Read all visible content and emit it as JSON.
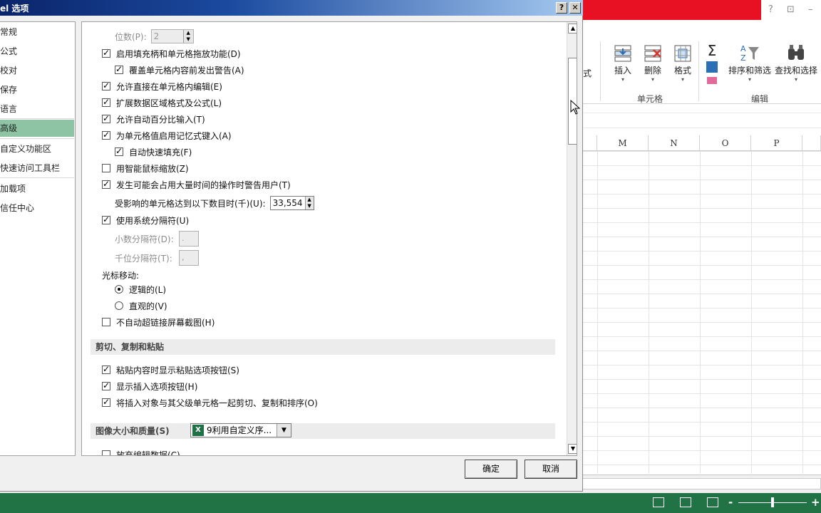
{
  "dialog": {
    "title": "el 选项",
    "help_button": "?",
    "close_button": "✕",
    "ok_label": "确定",
    "cancel_label": "取消"
  },
  "nav": {
    "items": [
      {
        "label": "常规"
      },
      {
        "label": "公式"
      },
      {
        "label": "校对"
      },
      {
        "label": "保存"
      },
      {
        "label": "语言"
      },
      {
        "label": "高级"
      },
      {
        "label": "自定义功能区"
      },
      {
        "label": "快速访问工具栏"
      },
      {
        "label": "加载项"
      },
      {
        "label": "信任中心"
      }
    ],
    "active": "高级"
  },
  "options": {
    "decimal_places_label": "位数(P):",
    "decimal_places_value": "2",
    "fill_handle": {
      "label": "启用填充柄和单元格拖放功能(D)",
      "checked": true
    },
    "overwrite_warn": {
      "label": "覆盖单元格内容前发出警告(A)",
      "checked": true
    },
    "edit_in_cell": {
      "label": "允许直接在单元格内编辑(E)",
      "checked": true
    },
    "extend_formats": {
      "label": "扩展数据区域格式及公式(L)",
      "checked": true
    },
    "auto_percent": {
      "label": "允许自动百分比输入(T)",
      "checked": true
    },
    "autocomplete": {
      "label": "为单元格值启用记忆式键入(A)",
      "checked": true
    },
    "flash_fill": {
      "label": "自动快速填充(F)",
      "checked": true
    },
    "intellimouse_zoom": {
      "label": "用智能鼠标缩放(Z)",
      "checked": false
    },
    "time_warn": {
      "label": "发生可能会占用大量时间的操作时警告用户(T)",
      "checked": true
    },
    "affected_cells_label": "受影响的单元格达到以下数目时(千)(U):",
    "affected_cells_value": "33,554",
    "system_separators": {
      "label": "使用系统分隔符(U)",
      "checked": true
    },
    "decimal_sep_label": "小数分隔符(D):",
    "decimal_sep_value": ".",
    "thousands_sep_label": "千位分隔符(T):",
    "thousands_sep_value": ",",
    "cursor_movement_label": "光标移动:",
    "logical": {
      "label": "逻辑的(L)",
      "selected": true
    },
    "visual": {
      "label": "直观的(V)",
      "selected": false
    },
    "no_hyperlink_screenshot": {
      "label": "不自动超链接屏幕截图(H)",
      "checked": false
    }
  },
  "cut_copy_paste": {
    "section_title": "剪切、复制和粘贴",
    "paste_options": {
      "label": "粘贴内容时显示粘贴选项按钮(S)",
      "checked": true
    },
    "insert_options": {
      "label": "显示插入选项按钮(H)",
      "checked": true
    },
    "cut_with_objects": {
      "label": "将插入对象与其父级单元格一起剪切、复制和排序(O)",
      "checked": true
    }
  },
  "image_size": {
    "section_title": "图像大小和质量(S)",
    "workbook_selected": "9利用自定义序...",
    "discard_edit_label": "放弃编辑数据(C)"
  },
  "excel_bg": {
    "ribbon_partial": "式",
    "insert_label": "插入",
    "delete_label": "删除",
    "format_label": "格式",
    "cells_group_label": "单元格",
    "sort_filter_label": "排序和筛选",
    "find_select_label": "查找和选择",
    "edit_group_label": "编辑",
    "columns": [
      "M",
      "N",
      "O",
      "P"
    ],
    "window_help": "?",
    "window_restore": "⊡",
    "window_min": "–",
    "zoom_minus": "-",
    "zoom_plus": "+"
  },
  "colors": {
    "accent_green": "#217346",
    "nav_active": "#8ec4a4",
    "title_red": "#e81123"
  }
}
